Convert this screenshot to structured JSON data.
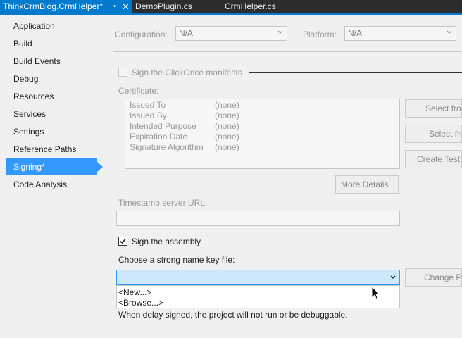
{
  "tabs": {
    "active": {
      "title": "ThinkCrmBlog.CrmHelper*",
      "pin_glyph": "⊸",
      "close_glyph": "✕"
    },
    "others": [
      "DemoPlugin.cs",
      "CrmHelper.cs"
    ]
  },
  "nav": {
    "items": [
      {
        "label": "Application"
      },
      {
        "label": "Build"
      },
      {
        "label": "Build Events"
      },
      {
        "label": "Debug"
      },
      {
        "label": "Resources"
      },
      {
        "label": "Services"
      },
      {
        "label": "Settings"
      },
      {
        "label": "Reference Paths"
      },
      {
        "label": "Signing*"
      },
      {
        "label": "Code Analysis"
      }
    ],
    "selected_index": 8
  },
  "config": {
    "configuration_label": "Configuration:",
    "configuration_value": "N/A",
    "platform_label": "Platform:",
    "platform_value": "N/A"
  },
  "clickonce": {
    "sign_manifests_label": "Sign the ClickOnce manifests",
    "sign_manifests_checked": false,
    "certificate_label": "Certificate:",
    "fields": [
      {
        "name": "Issued To",
        "value": "(none)"
      },
      {
        "name": "Issued By",
        "value": "(none)"
      },
      {
        "name": "Intended Purpose",
        "value": "(none)"
      },
      {
        "name": "Expiration Date",
        "value": "(none)"
      },
      {
        "name": "Signature Algorithm",
        "value": "(none)"
      }
    ],
    "select_store_button": "Select from Store...",
    "select_file_button": "Select from File...",
    "create_test_button": "Create Test Certificate...",
    "more_details_button": "More Details...",
    "timestamp_label": "Timestamp server URL:",
    "timestamp_value": ""
  },
  "assembly": {
    "sign_assembly_label": "Sign the assembly",
    "sign_assembly_checked": true,
    "key_file_label": "Choose a strong name key file:",
    "key_file_value": "",
    "change_password_button": "Change Password...",
    "dropdown_options": [
      "<New...>",
      "<Browse...>"
    ],
    "delay_note": "When delay signed, the project will not run or be debuggable."
  },
  "colors": {
    "accent": "#007acc",
    "nav_selected": "#3399ff",
    "dropdown_active": "#cde8fb"
  }
}
